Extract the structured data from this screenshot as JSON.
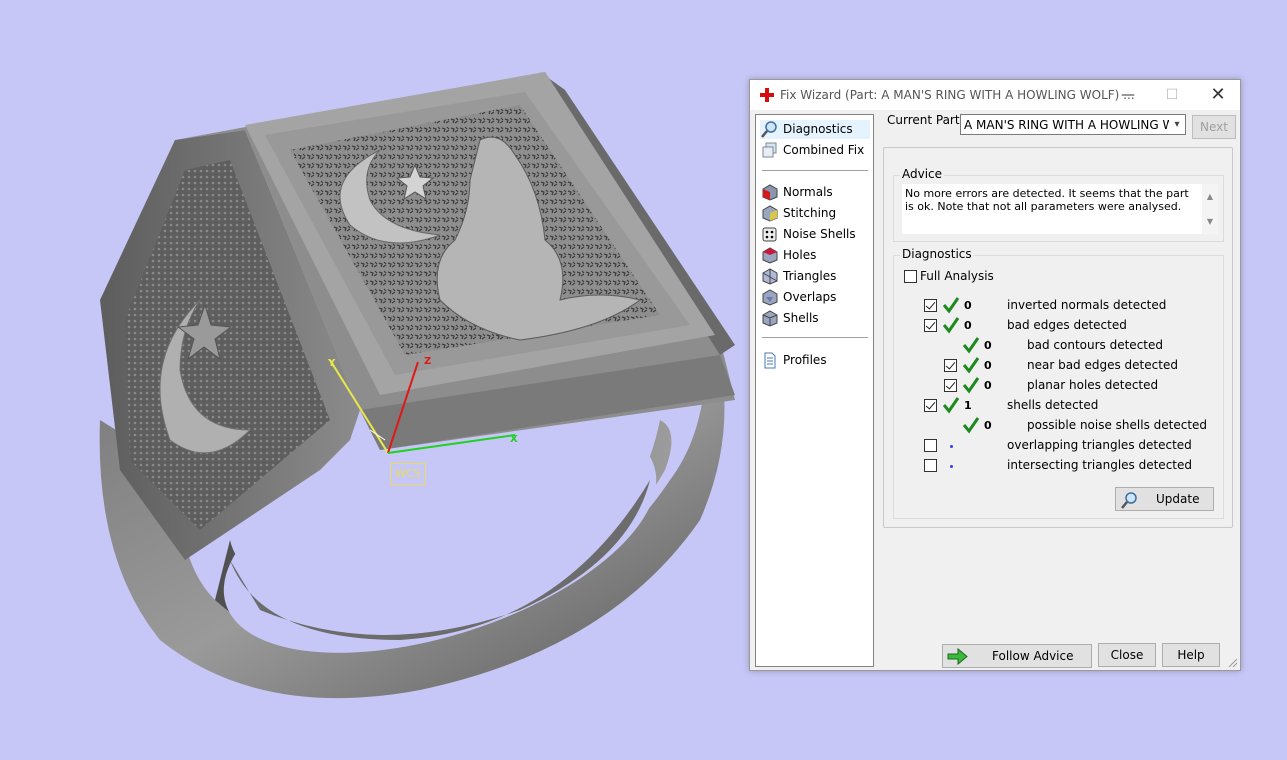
{
  "viewport": {
    "wcs_label": "WCS",
    "axis_labels": {
      "x": "X",
      "y": "Y",
      "z": "Z"
    }
  },
  "dialog": {
    "title": "Fix Wizard (Part: A MAN'S RING WITH A HOWLING WOLF) ...",
    "window_controls": {
      "minimize": "—",
      "maximize": "☐",
      "close": "✕"
    },
    "nav": {
      "items": [
        {
          "label": "Diagnostics",
          "icon": "magnifier-icon"
        },
        {
          "label": "Combined Fix",
          "icon": "stack-icon"
        }
      ],
      "tools": [
        {
          "label": "Normals",
          "icon": "cube-red-icon"
        },
        {
          "label": "Stitching",
          "icon": "cube-stitch-icon"
        },
        {
          "label": "Noise Shells",
          "icon": "dice-icon"
        },
        {
          "label": "Holes",
          "icon": "cube-hole-icon"
        },
        {
          "label": "Triangles",
          "icon": "cube-triangles-icon"
        },
        {
          "label": "Overlaps",
          "icon": "cube-overlap-icon"
        },
        {
          "label": "Shells",
          "icon": "cube-shell-icon"
        }
      ],
      "profiles": {
        "label": "Profiles",
        "icon": "document-icon"
      }
    },
    "current_part_label": "Current Part:",
    "current_part_value": "A MAN'S RING WITH A HOWLING WOLF",
    "next_label": "Next",
    "advice": {
      "title": "Advice",
      "text": "No more errors are detected. It seems that the part is ok. Note that not all parameters were analysed."
    },
    "diagnostics": {
      "title": "Diagnostics",
      "full_analysis_label": "Full Analysis",
      "rows": [
        {
          "count": "0",
          "label": "inverted normals detected"
        },
        {
          "count": "0",
          "label": "bad edges detected"
        },
        {
          "count": "0",
          "label": "bad contours detected"
        },
        {
          "count": "0",
          "label": "near bad edges detected"
        },
        {
          "count": "0",
          "label": "planar holes detected"
        },
        {
          "count": "1",
          "label": "shells detected"
        },
        {
          "count": "0",
          "label": "possible noise shells detected"
        },
        {
          "count": "",
          "label": "overlapping triangles detected"
        },
        {
          "count": "",
          "label": "intersecting triangles detected"
        }
      ],
      "update_label": "Update"
    },
    "buttons": {
      "follow_advice": "Follow Advice",
      "close": "Close",
      "help": "Help"
    },
    "colors": {
      "check": "#1d8a1d",
      "accent_red": "#d21010",
      "background": "#c6c7f6"
    }
  }
}
